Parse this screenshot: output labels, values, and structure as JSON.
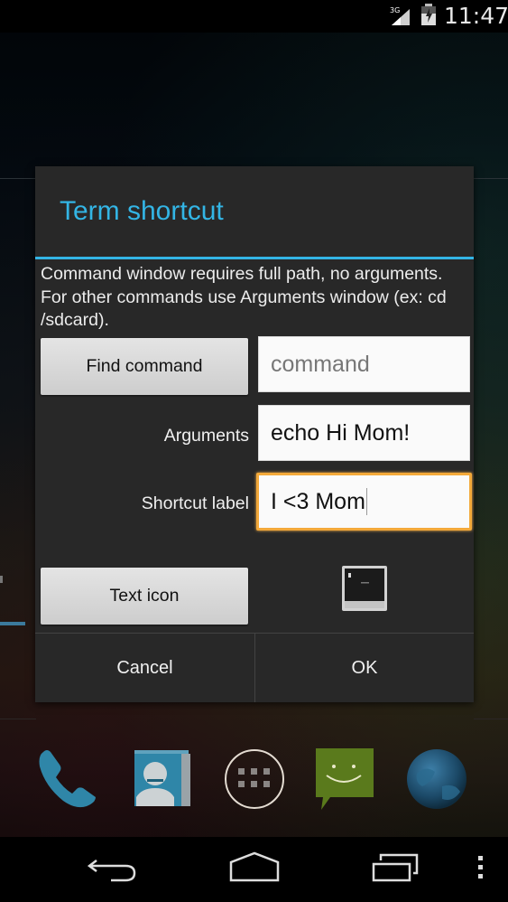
{
  "status_bar": {
    "time": "11:47",
    "network": "3G",
    "icons": [
      "signal-icon",
      "battery-charging-icon"
    ]
  },
  "dialog": {
    "title": "Term shortcut",
    "description": "Command window requires full path, no arguments. For other commands use Arguments window (ex: cd /sdcard).",
    "find_command_label": "Find command",
    "command_field": {
      "value": "",
      "placeholder": "command"
    },
    "arguments_label": "Arguments",
    "arguments_field": {
      "value": "echo Hi Mom!"
    },
    "shortcut_label_label": "Shortcut label",
    "shortcut_label_field": {
      "value": "I <3 Mom",
      "focused": true
    },
    "text_icon_label": "Text icon",
    "icon_preview": "terminal-icon",
    "cancel_label": "Cancel",
    "ok_label": "OK",
    "accent_color": "#33b5e5",
    "focus_color": "#f3a93a"
  },
  "dock": {
    "icons": [
      "phone-icon",
      "contacts-icon",
      "all-apps-icon",
      "messaging-icon",
      "browser-icon"
    ]
  },
  "nav_bar": {
    "buttons": [
      "back-icon",
      "home-icon",
      "recent-apps-icon",
      "overflow-menu-icon"
    ]
  }
}
